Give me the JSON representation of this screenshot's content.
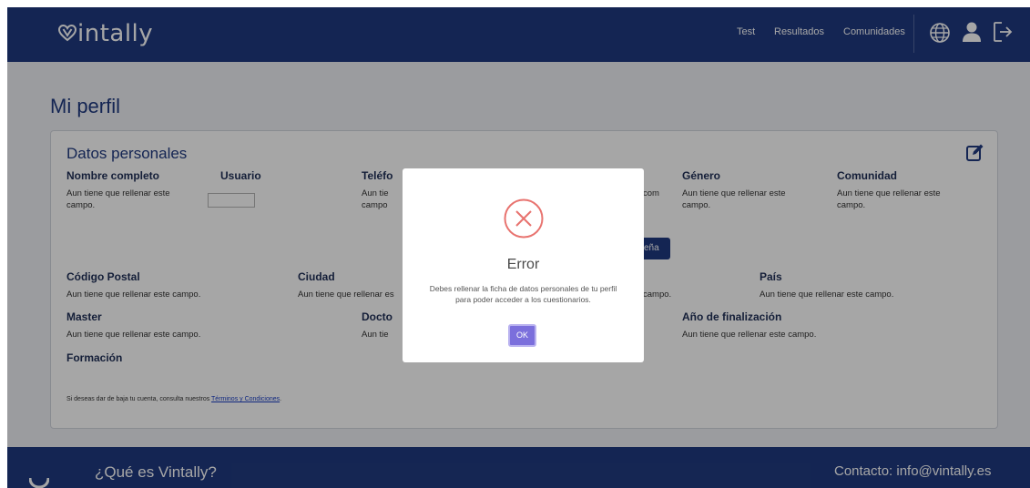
{
  "header": {
    "logo_text": "intally",
    "nav": {
      "test": "Test",
      "results": "Resultados",
      "communities": "Comunidades"
    },
    "icons": [
      "globe-icon",
      "user-icon",
      "logout-icon"
    ]
  },
  "page": {
    "title": "Mi perfil",
    "card_title": "Datos personales",
    "fields": {
      "nombre": {
        "label": "Nombre completo",
        "value": "Aun tiene que rellenar este campo."
      },
      "usuario": {
        "label": "Usuario"
      },
      "telefono": {
        "label": "Teléfo",
        "value": "Aun tie campo"
      },
      "email_fragment": "com",
      "genero": {
        "label": "Género",
        "value": "Aun tiene que rellenar este campo."
      },
      "comunidad": {
        "label": "Comunidad",
        "value": "Aun tiene que rellenar este campo."
      },
      "password_btn": "seña",
      "codigo_postal": {
        "label": "Código Postal",
        "value": "Aun tiene que rellenar este campo."
      },
      "ciudad": {
        "label": "Ciudad",
        "value": "Aun tiene que rellenar es"
      },
      "campo_fragment": "campo.",
      "pais": {
        "label": "País",
        "value": "Aun tiene que rellenar este campo."
      },
      "master": {
        "label": "Master",
        "value": "Aun tiene que rellenar este campo."
      },
      "doctorado": {
        "label": "Docto",
        "value": "Aun tie"
      },
      "anio_fin": {
        "label": "Año de finalización",
        "value": "Aun tiene que rellenar este campo."
      },
      "formacion": {
        "label": "Formación"
      }
    },
    "note": {
      "text": "Si deseas dar de baja tu cuenta, consulta nuestros ",
      "link": "Términos y Condiciones",
      "end": "."
    }
  },
  "footer": {
    "question": "¿Qué es Vintally?",
    "contact": "Contacto: info@vintally.es"
  },
  "modal": {
    "title": "Error",
    "message": "Debes rellenar la ficha de datos personales de tu perfil para poder acceder a los cuestionarios.",
    "ok": "OK",
    "icon": "error-x-icon",
    "accent": "#e8736f"
  },
  "colors": {
    "brand": "#203a80",
    "button": "#7b6fdc"
  }
}
